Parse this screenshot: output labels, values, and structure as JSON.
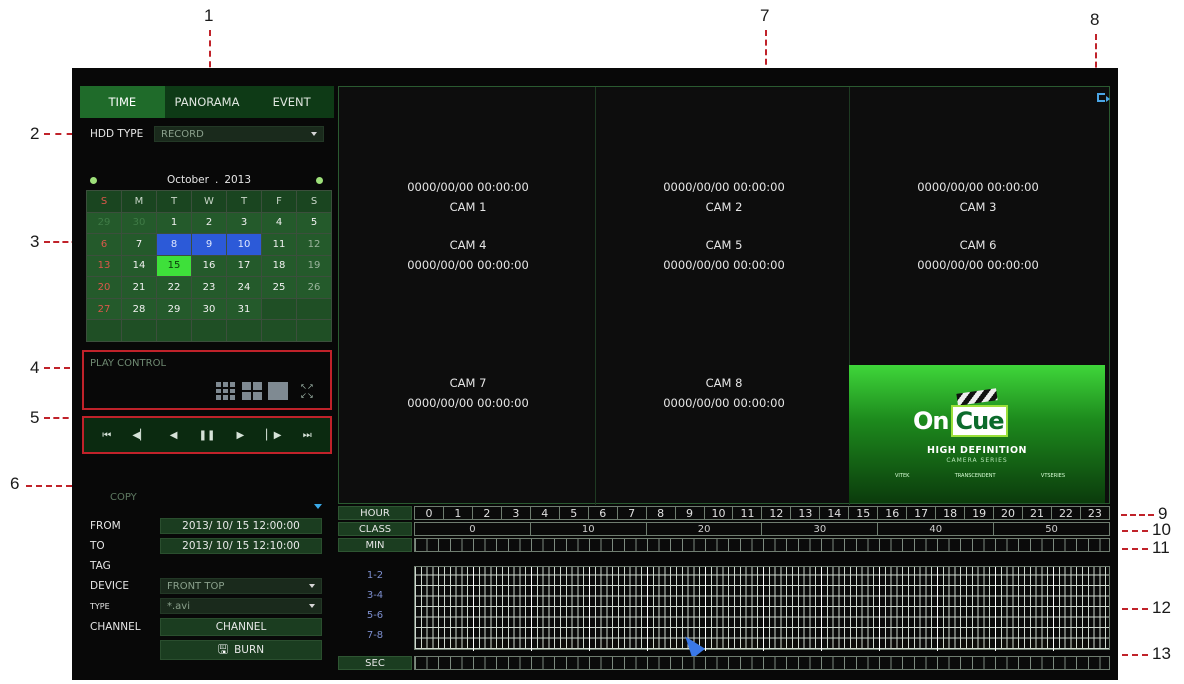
{
  "callouts": [
    "1",
    "2",
    "3",
    "4",
    "5",
    "6",
    "7",
    "8",
    "9",
    "10",
    "11",
    "12",
    "13"
  ],
  "tabs": [
    "TIME",
    "PANORAMA",
    "EVENT"
  ],
  "hdd": {
    "label": "HDD TYPE",
    "value": "RECORD"
  },
  "calendar": {
    "month": "October",
    "year": "2013",
    "dow": [
      "S",
      "M",
      "T",
      "W",
      "T",
      "F",
      "S"
    ],
    "weeks": [
      [
        "29",
        "30",
        "1",
        "2",
        "3",
        "4",
        "5"
      ],
      [
        "6",
        "7",
        "8",
        "9",
        "10",
        "11",
        "12"
      ],
      [
        "13",
        "14",
        "15",
        "16",
        "17",
        "18",
        "19"
      ],
      [
        "20",
        "21",
        "22",
        "23",
        "24",
        "25",
        "26"
      ],
      [
        "27",
        "28",
        "29",
        "30",
        "31",
        "",
        ""
      ],
      [
        "",
        "",
        "",
        "",
        "",
        "",
        ""
      ]
    ],
    "selected": [
      "8",
      "9",
      "10"
    ],
    "today": "15"
  },
  "play_control": {
    "title": "PLAY CONTROL"
  },
  "player_icons": [
    "skip-back-icon",
    "step-back-icon",
    "play-back-icon",
    "pause-icon",
    "play-icon",
    "step-forward-icon",
    "skip-forward-icon"
  ],
  "copy": {
    "title": "COPY",
    "from_label": "FROM",
    "from_value": "2013/ 10/ 15 12:00:00",
    "to_label": "TO",
    "to_value": "2013/ 10/ 15 12:10:00",
    "tag_label": "TAG",
    "device_label": "DEVICE",
    "device_value": "FRONT TOP",
    "type_label": "TYPE",
    "type_value": "*.avi",
    "channel_label": "CHANNEL",
    "channel_button": "CHANNEL",
    "burn_button": "BURN"
  },
  "cameras": [
    {
      "name": "CAM 1",
      "time": "0000/00/00 00:00:00"
    },
    {
      "name": "CAM 2",
      "time": "0000/00/00 00:00:00"
    },
    {
      "name": "CAM 3",
      "time": "0000/00/00 00:00:00"
    },
    {
      "name": "CAM 4",
      "time": "0000/00/00 00:00:00"
    },
    {
      "name": "CAM 5",
      "time": "0000/00/00 00:00:00"
    },
    {
      "name": "CAM 6",
      "time": "0000/00/00 00:00:00"
    },
    {
      "name": "CAM 7",
      "time": "0000/00/00 00:00:00"
    },
    {
      "name": "CAM 8",
      "time": "0000/00/00 00:00:00"
    }
  ],
  "logo": {
    "line1": "On",
    "line2": "Cue",
    "sub1": "HIGH DEFINITION",
    "sub2": "CAMERA SERIES",
    "brands": [
      "VITEK",
      "TRANSCENDENT",
      "VTSERIES"
    ]
  },
  "timeline": {
    "hour_label": "HOUR",
    "hours": [
      "0",
      "1",
      "2",
      "3",
      "4",
      "5",
      "6",
      "7",
      "8",
      "9",
      "10",
      "11",
      "12",
      "13",
      "14",
      "15",
      "16",
      "17",
      "18",
      "19",
      "20",
      "21",
      "22",
      "23"
    ],
    "class_label": "CLASS",
    "classes": [
      "0",
      "10",
      "20",
      "30",
      "40",
      "50"
    ],
    "min_label": "MIN",
    "channel_groups": [
      "1-2",
      "3-4",
      "5-6",
      "7-8"
    ],
    "sec_label": "SEC"
  },
  "colors": {
    "accent_green": "#1f6b2a",
    "selected_blue": "#2c5ad8",
    "today_green": "#3ee03a",
    "callout_red": "#c0222a"
  }
}
